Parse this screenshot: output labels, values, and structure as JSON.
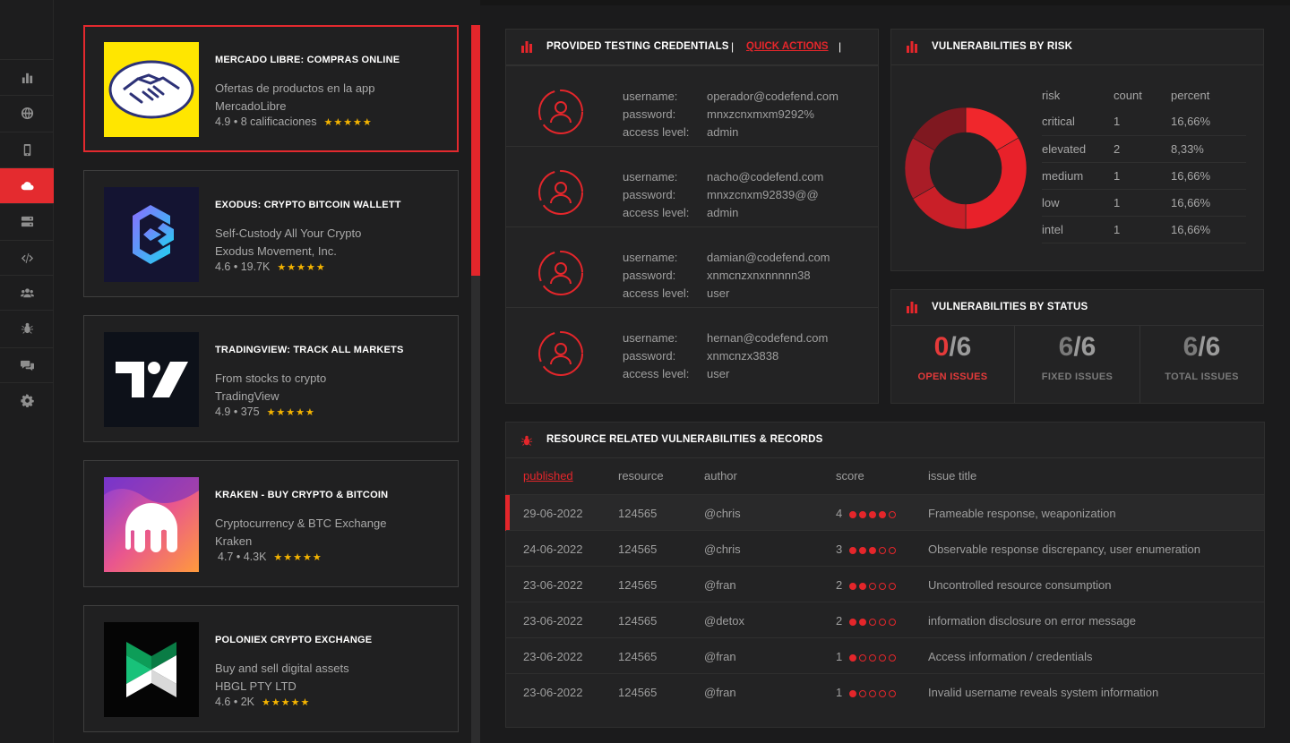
{
  "sidebar": {
    "items": [
      {
        "icon": "bar-chart-icon",
        "active": false
      },
      {
        "icon": "globe-icon",
        "active": false
      },
      {
        "icon": "mobile-icon",
        "active": false
      },
      {
        "icon": "cloud-icon",
        "active": true
      },
      {
        "icon": "server-icon",
        "active": false
      },
      {
        "icon": "code-icon",
        "active": false
      },
      {
        "icon": "users-icon",
        "active": false
      },
      {
        "icon": "bug-icon",
        "active": false
      },
      {
        "icon": "chat-icon",
        "active": false
      },
      {
        "icon": "gear-icon",
        "active": false
      }
    ]
  },
  "apps": [
    {
      "title": "MERCADO LIBRE: COMPRAS ONLINE",
      "desc1": "Ofertas de productos en la app",
      "desc2": "MercadoLibre",
      "rating": "4.9 • 8 calificaciones",
      "stars": "★★★★★",
      "icon": "mercadolibre-logo"
    },
    {
      "title": "EXODUS: CRYPTO BITCOIN WALLETT",
      "desc1": "Self-Custody All Your Crypto",
      "desc2": "Exodus Movement, Inc.",
      "rating": "4.6 • 19.7K",
      "stars": "★★★★★",
      "icon": "exodus-logo"
    },
    {
      "title": "TRADINGVIEW: TRACK ALL MARKETS",
      "desc1": "From stocks to crypto",
      "desc2": "TradingView",
      "rating": "4.9 • 375",
      "stars": "★★★★★",
      "icon": "tradingview-logo"
    },
    {
      "title": "KRAKEN - BUY CRYPTO & BITCOIN",
      "desc1": "Cryptocurrency & BTC Exchange",
      "desc2": "Kraken",
      "rating": "4.7 • 4.3K",
      "stars": "★★★★★",
      "icon": "kraken-logo"
    },
    {
      "title": "POLONIEX CRYPTO EXCHANGE",
      "desc1": "Buy and sell digital assets",
      "desc2": "HBGL PTY LTD",
      "rating": "4.6 • 2K",
      "stars": "★★★★★",
      "icon": "poloniex-logo"
    }
  ],
  "credentials": {
    "title": "PROVIDED TESTING CREDENTIALS",
    "separator": "|",
    "quick_actions": "QUICK ACTIONS",
    "labels": {
      "username": "username:",
      "password": "password:",
      "access": "access level:"
    },
    "rows": [
      {
        "username": "operador@codefend.com",
        "password": "mnxzcnxmxm9292%",
        "access": "admin"
      },
      {
        "username": "nacho@codefend.com",
        "password": "mnxzcnxm92839@@",
        "access": "admin"
      },
      {
        "username": "damian@codefend.com",
        "password": "xnmcnzxnxnnnnn38",
        "access": "user"
      },
      {
        "username": "hernan@codefend.com",
        "password": "xnmcnzx3838",
        "access": "user"
      }
    ]
  },
  "risk": {
    "title": "VULNERABILITIES BY RISK",
    "headers": [
      "risk",
      "count",
      "percent"
    ],
    "rows": [
      {
        "risk": "critical",
        "count": "1",
        "percent": "16,66%"
      },
      {
        "risk": "elevated",
        "count": "2",
        "percent": "8,33%"
      },
      {
        "risk": "medium",
        "count": "1",
        "percent": "16,66%"
      },
      {
        "risk": "low",
        "count": "1",
        "percent": "16,66%"
      },
      {
        "risk": "intel",
        "count": "1",
        "percent": "16,66%"
      }
    ],
    "donut_colors": [
      "#f0272c",
      "#e8212a",
      "#c91f28",
      "#a91c27",
      "#7f1820",
      "#941a24"
    ]
  },
  "status": {
    "title": "VULNERABILITIES BY STATUS",
    "stats": [
      {
        "num": "0",
        "den": "/6",
        "label": "OPEN ISSUES"
      },
      {
        "num": "6",
        "den": "/6",
        "label": "FIXED ISSUES"
      },
      {
        "num": "6",
        "den": "/6",
        "label": "TOTAL ISSUES"
      }
    ]
  },
  "vulns": {
    "title": "RESOURCE RELATED VULNERABILITIES & RECORDS",
    "headers": {
      "published": "published",
      "resource": "resource",
      "author": "author",
      "score": "score",
      "issue": "issue title"
    },
    "rows": [
      {
        "published": "29-06-2022",
        "resource": "124565",
        "author": "@chris",
        "score": 4,
        "issue": "Frameable response, weaponization"
      },
      {
        "published": "24-06-2022",
        "resource": "124565",
        "author": "@chris",
        "score": 3,
        "issue": "Observable response discrepancy, user enumeration"
      },
      {
        "published": "23-06-2022",
        "resource": "124565",
        "author": "@fran",
        "score": 2,
        "issue": "Uncontrolled resource consumption"
      },
      {
        "published": "23-06-2022",
        "resource": "124565",
        "author": "@detox",
        "score": 2,
        "issue": "information disclosure on error message"
      },
      {
        "published": "23-06-2022",
        "resource": "124565",
        "author": "@fran",
        "score": 1,
        "issue": "Access information / credentials"
      },
      {
        "published": "23-06-2022",
        "resource": "124565",
        "author": "@fran",
        "score": 1,
        "issue": "Invalid username reveals system information"
      }
    ]
  }
}
